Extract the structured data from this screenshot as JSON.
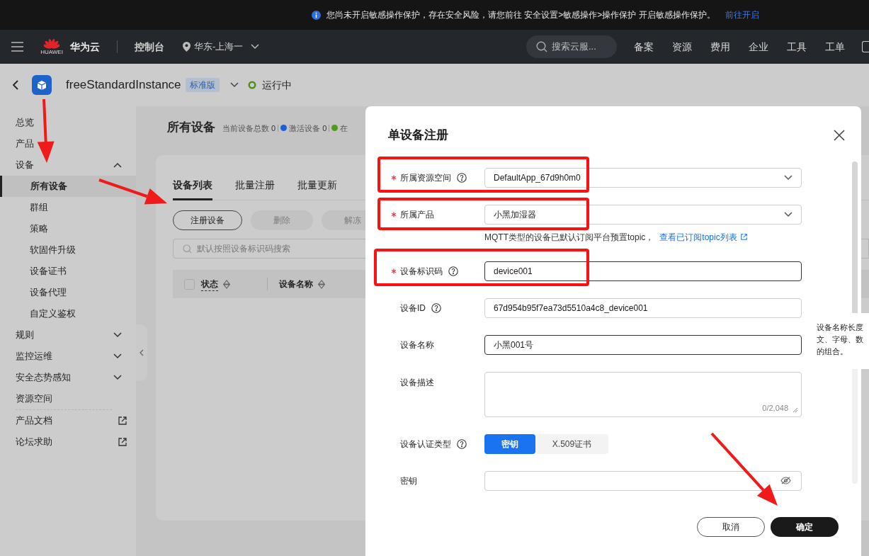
{
  "banner": {
    "text": "您尚未开启敏感操作保护，存在安全风险，请您前往 安全设置>敏感操作>操作保护 开启敏感操作保护。",
    "link": "前往开启"
  },
  "nav": {
    "logo_text": "HUAWEI",
    "brand": "华为云",
    "console": "控制台",
    "region": "华东-上海一",
    "search_placeholder": "搜索云服...",
    "links": [
      "备案",
      "资源",
      "费用",
      "企业",
      "工具",
      "工单"
    ]
  },
  "instance": {
    "name": "freeStandardInstance",
    "edition": "标准版",
    "status": "运行中"
  },
  "sidebar": {
    "items": [
      {
        "label": "总览",
        "kind": "item",
        "selected": false
      },
      {
        "label": "产品",
        "kind": "item",
        "selected": false
      },
      {
        "label": "设备",
        "kind": "group",
        "expanded": true,
        "selected": false,
        "children": [
          {
            "label": "所有设备",
            "selected": true
          },
          {
            "label": "群组",
            "selected": false
          },
          {
            "label": "策略",
            "selected": false
          },
          {
            "label": "软固件升级",
            "selected": false
          },
          {
            "label": "设备证书",
            "selected": false
          },
          {
            "label": "设备代理",
            "selected": false
          },
          {
            "label": "自定义鉴权",
            "selected": false
          }
        ]
      },
      {
        "label": "规则",
        "kind": "group",
        "expanded": false,
        "selected": false
      },
      {
        "label": "监控运维",
        "kind": "group",
        "expanded": false,
        "selected": false
      },
      {
        "label": "安全态势感知",
        "kind": "group",
        "expanded": false,
        "selected": false
      },
      {
        "label": "资源空间",
        "kind": "item",
        "selected": false
      },
      {
        "label": "产品文档",
        "kind": "external",
        "selected": false
      },
      {
        "label": "论坛求助",
        "kind": "external",
        "selected": false
      }
    ]
  },
  "page": {
    "title": "所有设备",
    "stats": [
      {
        "label": "当前设备总数",
        "value": "0"
      },
      {
        "label": "激活设备",
        "value": "0",
        "color": "#1f5fd6"
      },
      {
        "label": "在",
        "color": "#4f9a1f"
      }
    ],
    "tabs": [
      {
        "label": "设备列表",
        "selected": true
      },
      {
        "label": "批量注册",
        "selected": false
      },
      {
        "label": "批量更新",
        "selected": false
      }
    ],
    "actions": [
      {
        "label": "注册设备",
        "disabled": false
      },
      {
        "label": "删除",
        "disabled": true
      },
      {
        "label": "解冻",
        "disabled": true
      }
    ],
    "search_placeholder": "默认按照设备标识码搜索",
    "table": {
      "select_all": {
        "checked": false
      },
      "columns": [
        "状态",
        "设备名称"
      ]
    }
  },
  "dialog": {
    "title": "单设备注册",
    "fields": [
      {
        "kind": "select",
        "label": "所属资源空间",
        "required": true,
        "help": true,
        "value": "DefaultApp_67d9h0m0"
      },
      {
        "kind": "select",
        "label": "所属产品",
        "required": true,
        "help": false,
        "value": "小黑加湿器",
        "note": "MQTT类型的设备已默认订阅平台预置topic，",
        "note_link": "查看已订阅topic列表"
      },
      {
        "kind": "input",
        "label": "设备标识码",
        "required": true,
        "help": true,
        "value": "device001",
        "focused": true
      },
      {
        "kind": "input",
        "label": "设备ID",
        "required": false,
        "help": true,
        "value": "67d954b95f7ea73d5510a4c8_device001",
        "focused": false
      },
      {
        "kind": "input",
        "label": "设备名称",
        "required": false,
        "help": false,
        "value": "小黑001号",
        "focused": true
      },
      {
        "kind": "textarea",
        "label": "设备描述",
        "required": false,
        "help": false,
        "counter": "0/2,048"
      },
      {
        "kind": "segmented",
        "label": "设备认证类型",
        "required": false,
        "help": true,
        "options": [
          {
            "label": "密钥",
            "selected": true
          },
          {
            "label": "X.509证书",
            "selected": false
          }
        ]
      },
      {
        "kind": "password",
        "label": "密钥",
        "required": false,
        "help": false
      }
    ],
    "buttons": [
      {
        "label": "取消",
        "primary": false
      },
      {
        "label": "确定",
        "primary": true
      }
    ]
  },
  "tooltip": {
    "lines": [
      "设备名称长度",
      "文、字母、数",
      "的组合。"
    ]
  }
}
